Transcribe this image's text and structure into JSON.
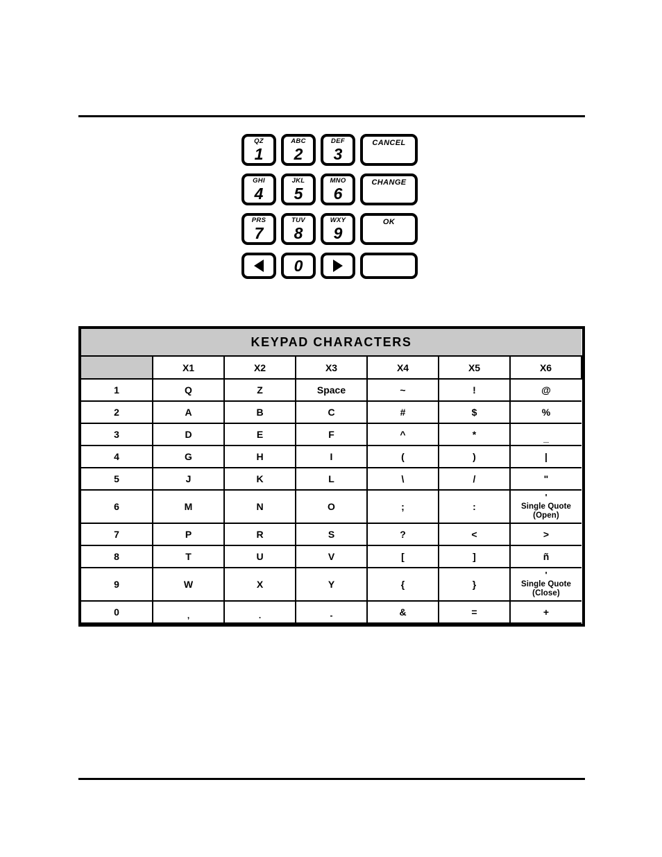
{
  "page": {
    "rules": {
      "top_label": "header-rule",
      "bottom_label": "footer-rule"
    }
  },
  "keypad": {
    "rows": [
      [
        {
          "name": "key-1",
          "hint": "QZ",
          "digit": "1",
          "type": "num"
        },
        {
          "name": "key-2",
          "hint": "ABC",
          "digit": "2",
          "type": "num"
        },
        {
          "name": "key-3",
          "hint": "DEF",
          "digit": "3",
          "type": "num"
        },
        {
          "name": "key-cancel",
          "label": "CANCEL",
          "type": "wide"
        }
      ],
      [
        {
          "name": "key-4",
          "hint": "GHI",
          "digit": "4",
          "type": "num"
        },
        {
          "name": "key-5",
          "hint": "JKL",
          "digit": "5",
          "type": "num"
        },
        {
          "name": "key-6",
          "hint": "MNO",
          "digit": "6",
          "type": "num"
        },
        {
          "name": "key-change",
          "label": "CHANGE",
          "type": "wide"
        }
      ],
      [
        {
          "name": "key-7",
          "hint": "PRS",
          "digit": "7",
          "type": "num"
        },
        {
          "name": "key-8",
          "hint": "TUV",
          "digit": "8",
          "type": "num"
        },
        {
          "name": "key-9",
          "hint": "WXY",
          "digit": "9",
          "type": "num"
        },
        {
          "name": "key-ok",
          "label": "OK",
          "type": "wide"
        }
      ],
      [
        {
          "name": "key-arrow-left",
          "icon": "arrow-left-icon",
          "type": "nav"
        },
        {
          "name": "key-0",
          "digit": "0",
          "type": "nav"
        },
        {
          "name": "key-arrow-right",
          "icon": "arrow-right-icon",
          "type": "nav"
        },
        {
          "name": "key-blank",
          "label": "",
          "type": "wide-short"
        }
      ]
    ],
    "labels": {
      "key_1_hint": "QZ",
      "key_2_hint": "ABC",
      "key_3_hint": "DEF",
      "key_4_hint": "GHI",
      "key_5_hint": "JKL",
      "key_6_hint": "MNO",
      "key_7_hint": "PRS",
      "key_8_hint": "TUV",
      "key_9_hint": "WXY",
      "cancel": "CANCEL",
      "change": "CHANGE",
      "ok": "OK",
      "blank": ""
    }
  },
  "table": {
    "title": "KEYPAD CHARACTERS",
    "corner": "",
    "columns": [
      "X1",
      "X2",
      "X3",
      "X4",
      "X5",
      "X6"
    ],
    "rows": [
      {
        "label": "1",
        "cells": [
          "Q",
          "Z",
          "Space",
          "~",
          "!",
          "@"
        ]
      },
      {
        "label": "2",
        "cells": [
          "A",
          "B",
          "C",
          "#",
          "$",
          "%"
        ]
      },
      {
        "label": "3",
        "cells": [
          "D",
          "E",
          "F",
          "^",
          "*",
          "_"
        ]
      },
      {
        "label": "4",
        "cells": [
          "G",
          "H",
          "I",
          "(",
          ")",
          "|"
        ]
      },
      {
        "label": "5",
        "cells": [
          "J",
          "K",
          "L",
          "\\",
          "/",
          "\""
        ]
      },
      {
        "label": "6",
        "cells": [
          "M",
          "N",
          "O",
          ";",
          ":",
          "'"
        ],
        "x6_caption": "Single Quote (Open)"
      },
      {
        "label": "7",
        "cells": [
          "P",
          "R",
          "S",
          "?",
          "<",
          ">"
        ]
      },
      {
        "label": "8",
        "cells": [
          "T",
          "U",
          "V",
          "[",
          "]",
          "ñ"
        ]
      },
      {
        "label": "9",
        "cells": [
          "W",
          "X",
          "Y",
          "{",
          "}",
          "'"
        ],
        "x6_caption": "Single Quote (Close)"
      },
      {
        "label": "0",
        "cells": [
          ",",
          ".",
          "-",
          "&",
          "=",
          "+"
        ]
      }
    ],
    "colors": {
      "header_gray": "#c9c9c9",
      "border": "#000000",
      "background": "#ffffff"
    }
  }
}
